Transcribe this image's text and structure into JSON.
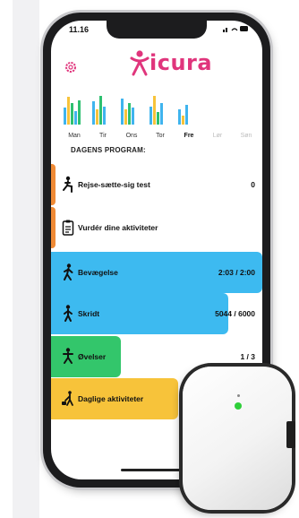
{
  "status_bar": {
    "time": "11.16",
    "icons": "▪▪ ≋ ▬"
  },
  "brand": {
    "logo_text": "icura",
    "accent_color": "#e0357c"
  },
  "week": {
    "days": [
      {
        "label": "Man",
        "style": "normal",
        "levels": [
          0.55,
          0.9,
          0.7,
          0.45,
          0.8
        ],
        "colors": [
          "#3fb4ee",
          "#f7c33a",
          "#2ec070",
          "#3fb4ee",
          "#2ec070"
        ]
      },
      {
        "label": "Tir",
        "style": "normal",
        "levels": [
          0.75,
          0.5,
          0.95,
          0.6
        ],
        "colors": [
          "#3fb4ee",
          "#f7c33a",
          "#2ec070",
          "#3fb4ee"
        ]
      },
      {
        "label": "Ons",
        "style": "normal",
        "levels": [
          0.85,
          0.5,
          0.7,
          0.55
        ],
        "colors": [
          "#3fb4ee",
          "#f7c33a",
          "#2ec070",
          "#3fb4ee"
        ]
      },
      {
        "label": "Tor",
        "style": "normal",
        "levels": [
          0.6,
          0.95,
          0.4,
          0.7
        ],
        "colors": [
          "#3fb4ee",
          "#f7c33a",
          "#2ec070",
          "#3fb4ee"
        ]
      },
      {
        "label": "Fre",
        "style": "bold",
        "levels": [
          0.5,
          0.3,
          0.65
        ],
        "colors": [
          "#3fb4ee",
          "#f7c33a",
          "#3fb4ee"
        ]
      },
      {
        "label": "Lør",
        "style": "dim",
        "levels": [],
        "colors": []
      },
      {
        "label": "Søn",
        "style": "dim",
        "levels": [],
        "colors": []
      }
    ]
  },
  "program": {
    "title": "DAGENS PROGRAM:",
    "items": [
      {
        "label": "Rejse-sætte-sig test",
        "value": "0",
        "icon": "sit-stand-icon",
        "color": "#ffffff",
        "progress": 1.0,
        "accent": true
      },
      {
        "label": "Vurdér dine aktiviteter",
        "value": "",
        "icon": "clipboard-icon",
        "color": "#ffffff",
        "progress": 1.0,
        "accent": true
      },
      {
        "label": "Bevægelse",
        "value": "2:03 / 2:00",
        "icon": "walking-person-icon",
        "color": "#3dbaf0",
        "progress": 1.0,
        "accent": false
      },
      {
        "label": "Skridt",
        "value": "5044 / 6000",
        "icon": "steps-person-icon",
        "color": "#3dbaf0",
        "progress": 0.84,
        "accent": false
      },
      {
        "label": "Øvelser",
        "value": "1 / 3",
        "icon": "exercise-person-icon",
        "color": "#33c66b",
        "progress": 0.33,
        "accent": false
      },
      {
        "label": "Daglige aktiviteter",
        "value": "",
        "icon": "vacuum-icon",
        "color": "#f7c33a",
        "progress": 0.6,
        "accent": false
      }
    ]
  },
  "device": {
    "name_icon": "activity-sensor-device",
    "led_color": "#2fcf3a"
  }
}
